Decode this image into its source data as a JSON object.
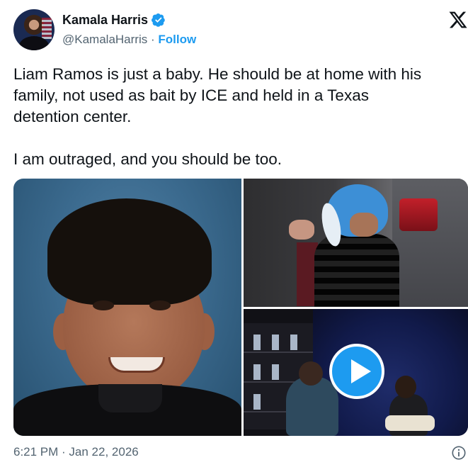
{
  "author": {
    "name": "Kamala Harris",
    "handle": "@KamalaHarris",
    "separator": "·",
    "follow_label": "Follow",
    "verified": true
  },
  "tweet": {
    "lines_paragraph1": [
      "Liam Ramos is just a baby. He should be at home with his",
      "family, not used as bait by ICE and held in a Texas",
      "detention center."
    ],
    "paragraph2": "I am outraged, and you should be too.",
    "timestamp": "6:21 PM · Jan 22, 2026"
  },
  "media": [
    {
      "kind": "photo"
    },
    {
      "kind": "photo"
    },
    {
      "kind": "video"
    }
  ],
  "icons": {
    "verified": "verified-badge-icon",
    "platform": "x-logo-icon",
    "info": "info-icon",
    "play": "play-icon"
  },
  "colors": {
    "accent": "#1d9bf0",
    "text": "#0f1419",
    "secondary": "#536471"
  }
}
